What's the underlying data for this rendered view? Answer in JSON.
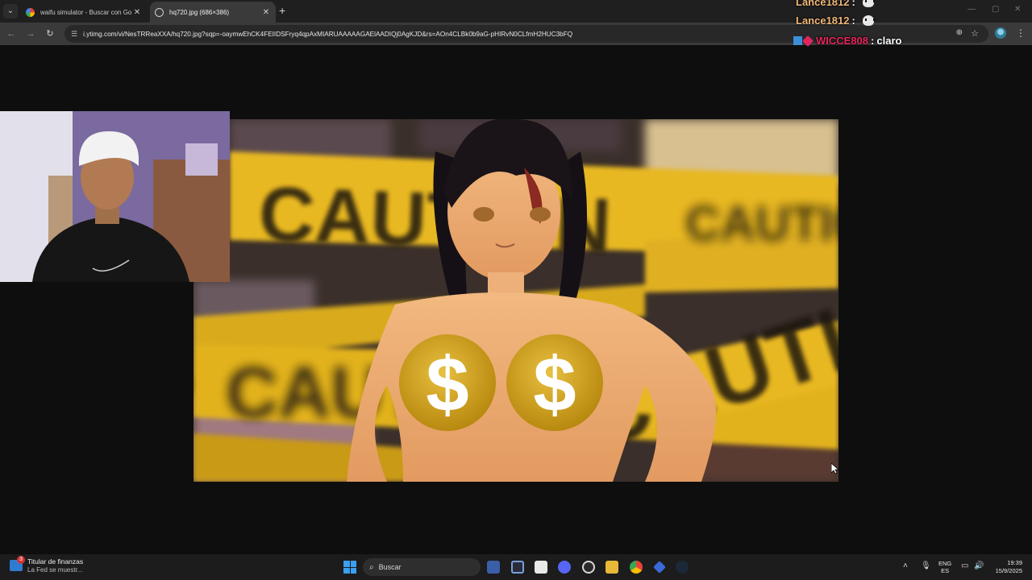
{
  "browser": {
    "tabs": [
      {
        "title": "waifu simulator - Buscar con Go",
        "active": false,
        "favicon": "google-icon"
      },
      {
        "title": "hq720.jpg (686×386)",
        "active": true,
        "favicon": "globe-icon"
      }
    ],
    "new_tab_label": "+",
    "url": "i.ytimg.com/vi/NesTRReaXXA/hq720.jpg?sqp=-oaymwEhCK4FEIIDSFryq4qpAxMIARUAAAAAGAElAADIQj0AgKJD&rs=AOn4CLBk0b9aG-pHIRvN0CLfmH2HUC3bFQ"
  },
  "chat": {
    "lines": [
      {
        "user": "Lance1812",
        "sep": ":",
        "emote": "emote-icon"
      },
      {
        "user": "Lance1812",
        "sep": ":",
        "emote": "emote-icon"
      },
      {
        "user": "WICCE808",
        "sep": ":",
        "message": "claro"
      }
    ]
  },
  "thumbnail": {
    "caution_text": "CAUTION",
    "currency_symbol": "$"
  },
  "taskbar": {
    "news_badge": "3",
    "news_title": "Titular de finanzas",
    "news_subtitle": "La Fed se muestr...",
    "search_label": "Buscar",
    "lang_top": "ENG",
    "lang_bottom": "ES",
    "time": "19:39",
    "date": "15/9/2025"
  },
  "colors": {
    "caution_yellow": "#e8b820",
    "coin_gold": "#cfa01a",
    "chat_user": "#f0b878",
    "chat_user2": "#e8245a"
  }
}
